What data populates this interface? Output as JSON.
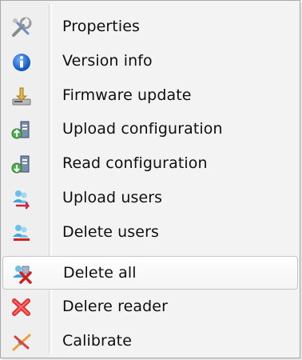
{
  "menu": {
    "items": [
      {
        "label": "Properties",
        "icon": "properties-wrench-icon"
      },
      {
        "label": "Version info",
        "icon": "info-icon"
      },
      {
        "label": "Firmware update",
        "icon": "firmware-update-icon"
      },
      {
        "label": "Upload configuration",
        "icon": "upload-configuration-icon"
      },
      {
        "label": "Read configuration",
        "icon": "read-configuration-icon"
      },
      {
        "label": "Upload users",
        "icon": "upload-users-icon"
      },
      {
        "label": "Delete users",
        "icon": "delete-users-icon"
      },
      {
        "label": "Delete all",
        "icon": "delete-all-icon",
        "highlighted": true
      },
      {
        "label": "Delere reader",
        "icon": "delete-reader-icon"
      },
      {
        "label": "Calibrate",
        "icon": "calibrate-icon"
      }
    ]
  },
  "colors": {
    "info_blue": "#1e6ed8",
    "red_x": "#d02020",
    "user_cyan": "#3aa7d8",
    "green_arrow": "#3aa83a"
  }
}
